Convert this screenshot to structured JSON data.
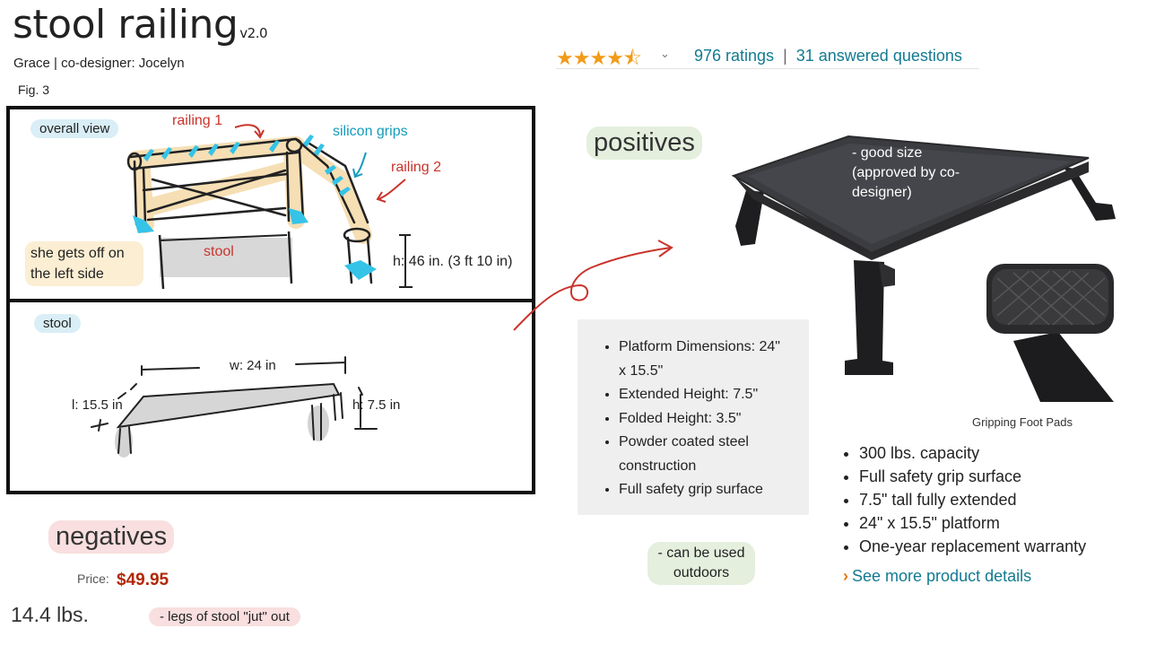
{
  "header": {
    "title": "stool railing",
    "version": "v2.0",
    "authors": "Grace | co-designer: Jocelyn",
    "figure": "Fig. 3"
  },
  "overall_panel": {
    "tag": "overall view",
    "railing1": "railing 1",
    "railing2": "railing 2",
    "grips": "silicon grips",
    "stool_label": "stool",
    "note": "she gets off on the left side",
    "height": "h: 46 in. (3 ft 10 in)"
  },
  "stool_panel": {
    "tag": "stool",
    "width": "w: 24 in",
    "length": "l: 15.5 in",
    "height": "h: 7.5 in"
  },
  "product": {
    "stars": "★★★★⯪",
    "ratings": "976 ratings",
    "separator": "|",
    "questions": "31 answered questions",
    "specs": [
      "Platform Dimensions: 24\" x 15.5\"",
      "Extended Height: 7.5\"",
      "Folded Height: 3.5\"",
      "Powder coated steel construction",
      "Full safety grip surface"
    ],
    "foot_caption": "Gripping Foot Pads",
    "features": [
      "300 lbs. capacity",
      "Full safety grip surface",
      "7.5\" tall fully extended",
      "24\" x 15.5\" platform",
      "One-year replacement warranty"
    ],
    "more_link": "See more product details",
    "price_label": "Price:",
    "price": "$49.95",
    "weight": "14.4 lbs."
  },
  "notes": {
    "positives": "positives",
    "good_size": "- good size (approved by co-designer)",
    "outdoors": "- can be used outdoors",
    "negatives": "negatives",
    "legs": "- legs of stool \"jut\" out"
  }
}
